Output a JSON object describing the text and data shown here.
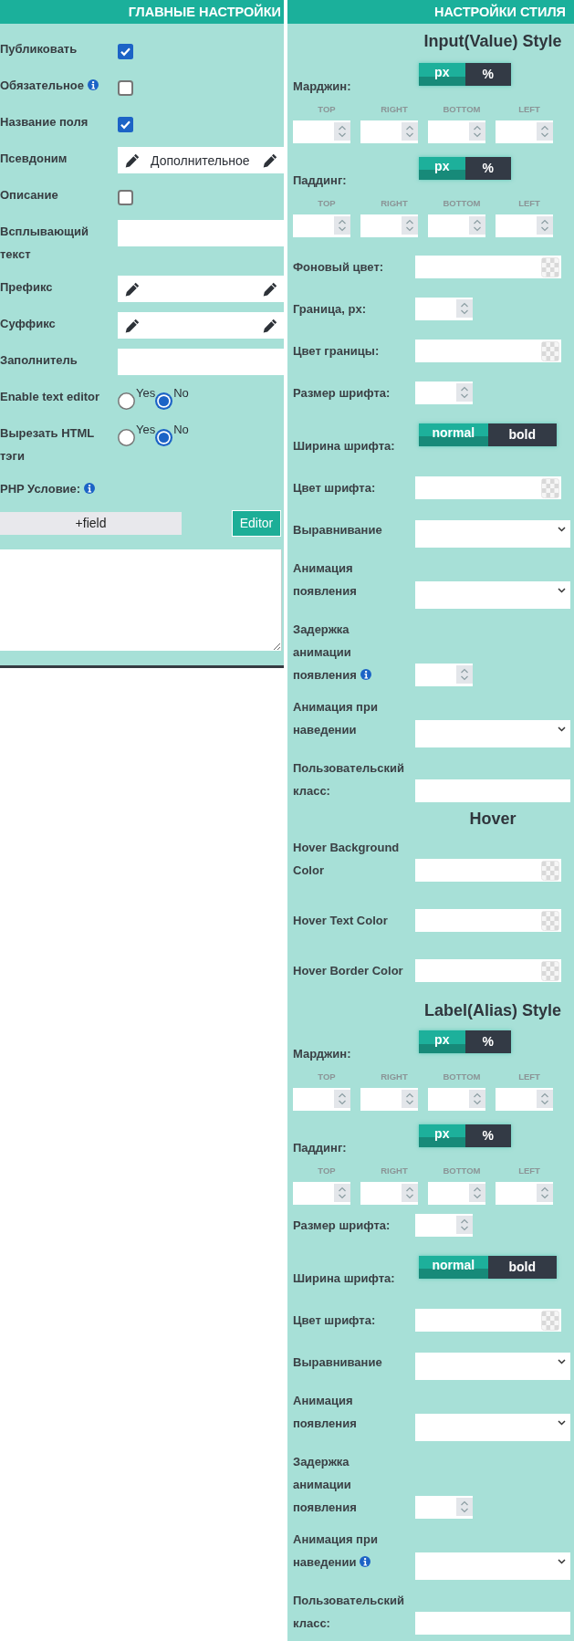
{
  "main_settings": {
    "title": "ГЛАВНЫЕ НАСТРОЙКИ",
    "rows": [
      {
        "kind": "checkbox",
        "label": "Публиковать",
        "info": false,
        "checked": true
      },
      {
        "kind": "checkbox",
        "label": "Обязательное",
        "info": true,
        "checked": false
      },
      {
        "kind": "checkbox",
        "label": "Название поля",
        "info": false,
        "checked": true
      },
      {
        "kind": "pencil_field",
        "label": "Псевдоним",
        "info": false,
        "value": "Дополнительное"
      },
      {
        "kind": "checkbox",
        "label": "Описание",
        "info": false,
        "checked": false
      },
      {
        "kind": "text",
        "label": "Всплывающий текст",
        "info": false
      },
      {
        "kind": "pencil_field",
        "label": "Префикс",
        "info": false
      },
      {
        "kind": "pencil_field",
        "label": "Суффикс",
        "info": false
      },
      {
        "kind": "text",
        "label": "Заполнитель",
        "info": false
      },
      {
        "kind": "radio",
        "label": "Enable text editor",
        "info": false,
        "options": [
          {
            "label": "Yes",
            "selected": false
          },
          {
            "label": "No",
            "selected": true
          }
        ]
      },
      {
        "kind": "radio",
        "label": "Вырезать HTML тэги",
        "info": false,
        "options": [
          {
            "label": "Yes",
            "selected": false
          },
          {
            "label": "No",
            "selected": true
          }
        ]
      },
      {
        "kind": "label",
        "label": "PHP Условие:",
        "info": true
      }
    ],
    "add_field_button": "+field",
    "editor_button": "Editor"
  },
  "style_settings": {
    "title": "НАСТРОЙКИ СТИЛЯ",
    "sections": [
      {
        "heading": "Input(Value) Style",
        "rows": [
          {
            "kind": "sides",
            "label": "Марджин:",
            "info": false,
            "options": [
              {
                "label": "px",
                "selected": true
              },
              {
                "label": "%",
                "selected": false
              }
            ],
            "sides": [
              "TOP",
              "RIGHT",
              "BOTTOM",
              "LEFT"
            ]
          },
          {
            "kind": "sides",
            "label": "Паддинг:",
            "info": false,
            "options": [
              {
                "label": "px",
                "selected": true
              },
              {
                "label": "%",
                "selected": false
              }
            ],
            "sides": [
              "TOP",
              "RIGHT",
              "BOTTOM",
              "LEFT"
            ]
          },
          {
            "kind": "color",
            "label": "Фоновый цвет:",
            "info": false
          },
          {
            "kind": "number",
            "label": "Граница, px:",
            "info": false
          },
          {
            "kind": "color",
            "label": "Цвет границы:",
            "info": false
          },
          {
            "kind": "number",
            "label": "Размер шрифта:",
            "info": false
          },
          {
            "kind": "toggle",
            "label": "Ширина шрифта:",
            "info": false,
            "options": [
              {
                "label": "normal",
                "selected": true
              },
              {
                "label": "bold",
                "selected": false
              }
            ]
          },
          {
            "kind": "color",
            "label": "Цвет шрифта:",
            "info": false
          },
          {
            "kind": "select",
            "label": "Выравнивание",
            "info": false
          },
          {
            "kind": "select",
            "label": "Анимация появления",
            "info": false
          },
          {
            "kind": "number",
            "label": "Задержка анимации появления",
            "info": true
          },
          {
            "kind": "select",
            "label": "Анимация при наведении",
            "info": false
          },
          {
            "kind": "text",
            "label": "Пользовательский класс:",
            "info": false
          }
        ]
      },
      {
        "heading": "Hover",
        "rows": [
          {
            "kind": "color",
            "label": "Hover Background Color",
            "info": false
          },
          {
            "kind": "color",
            "label": "Hover Text Color",
            "info": false
          },
          {
            "kind": "color",
            "label": "Hover Border Color",
            "info": false
          }
        ]
      },
      {
        "heading": "Label(Alias) Style",
        "rows": [
          {
            "kind": "sides",
            "label": "Марджин:",
            "info": false,
            "options": [
              {
                "label": "px",
                "selected": true
              },
              {
                "label": "%",
                "selected": false
              }
            ],
            "sides": [
              "TOP",
              "RIGHT",
              "BOTTOM",
              "LEFT"
            ]
          },
          {
            "kind": "sides",
            "label": "Паддинг:",
            "info": false,
            "options": [
              {
                "label": "px",
                "selected": true
              },
              {
                "label": "%",
                "selected": false
              }
            ],
            "sides": [
              "TOP",
              "RIGHT",
              "BOTTOM",
              "LEFT"
            ]
          },
          {
            "kind": "number",
            "label": "Размер шрифта:",
            "info": false
          },
          {
            "kind": "toggle",
            "label": "Ширина шрифта:",
            "info": false,
            "options": [
              {
                "label": "normal",
                "selected": true
              },
              {
                "label": "bold",
                "selected": false
              }
            ]
          },
          {
            "kind": "color",
            "label": "Цвет шрифта:",
            "info": false
          },
          {
            "kind": "select",
            "label": "Выравнивание",
            "info": false
          },
          {
            "kind": "select",
            "label": "Анимация появления",
            "info": false
          },
          {
            "kind": "number",
            "label": "Задержка анимации появления",
            "info": false
          },
          {
            "kind": "select",
            "label": "Анимация при наведении",
            "info": true
          },
          {
            "kind": "text",
            "label": "Пользовательский класс:",
            "info": false
          }
        ]
      }
    ]
  }
}
